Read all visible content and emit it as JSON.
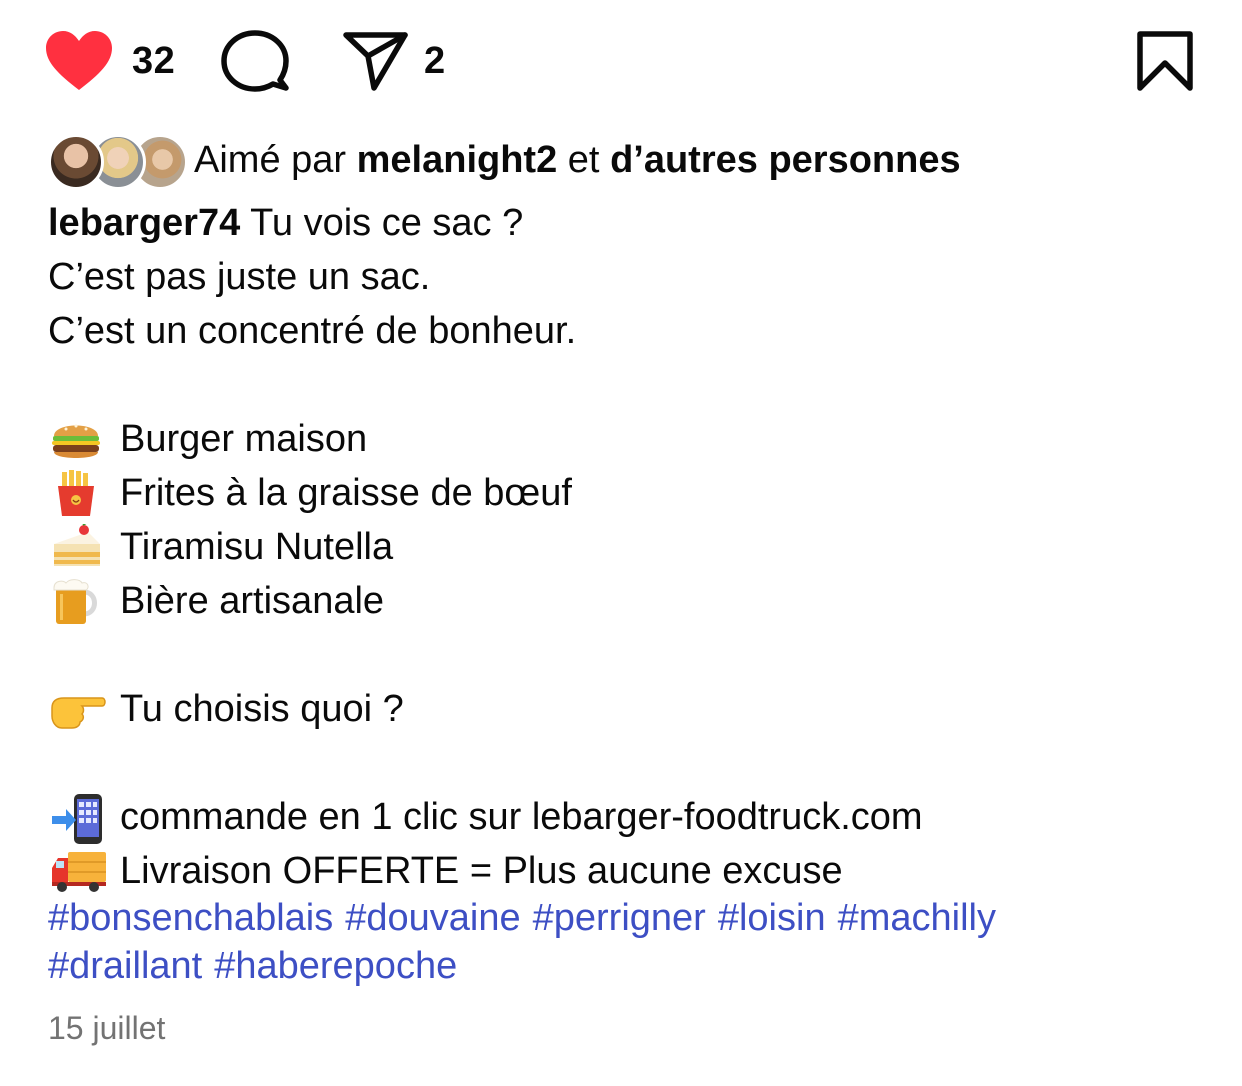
{
  "actions": {
    "like_count": "32",
    "share_count": "2",
    "like_color": "#ff3040",
    "icons": [
      "heart-icon",
      "comment-icon",
      "share-icon",
      "bookmark-icon"
    ]
  },
  "likes": {
    "prefix": "Aimé par",
    "user": "melanight2",
    "connector": "et",
    "others": "d’autres personnes"
  },
  "caption": {
    "username": "lebarger74",
    "first_line": "Tu vois ce sac ?",
    "line2": "C’est pas juste un sac.",
    "line3": "C’est un concentré de bonheur.",
    "menu": [
      {
        "icon": "burger-emoji",
        "text": "Burger maison"
      },
      {
        "icon": "fries-emoji",
        "text": "Frites à la graisse de bœuf"
      },
      {
        "icon": "cake-emoji",
        "text": "Tiramisu Nutella"
      },
      {
        "icon": "beer-emoji",
        "text": "Bière artisanale"
      }
    ],
    "question": {
      "icon": "pointing-hand-emoji",
      "text": "Tu choisis quoi ?"
    },
    "order": {
      "icon": "phone-arrow-emoji",
      "text": "commande en 1 clic sur lebarger-foodtruck.com"
    },
    "delivery": {
      "icon": "truck-emoji",
      "text": "Livraison OFFERTE = Plus aucune excuse"
    }
  },
  "hashtags": [
    "#bonsenchablais",
    "#douvaine",
    "#perrigner",
    "#loisin",
    "#machilly",
    "#draillant",
    "#haberepoche"
  ],
  "hashtag_color": "#3d4fc4",
  "date": "15 juillet"
}
